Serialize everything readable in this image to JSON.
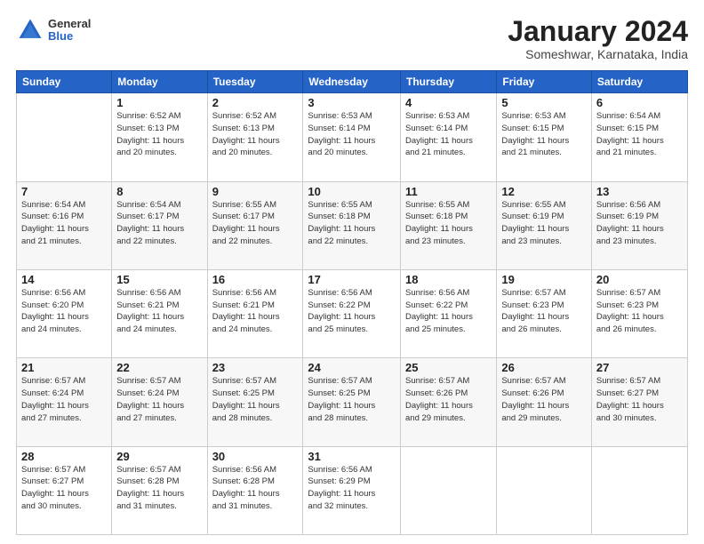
{
  "header": {
    "logo_general": "General",
    "logo_blue": "Blue",
    "title": "January 2024",
    "subtitle": "Someshwar, Karnataka, India"
  },
  "weekdays": [
    "Sunday",
    "Monday",
    "Tuesday",
    "Wednesday",
    "Thursday",
    "Friday",
    "Saturday"
  ],
  "weeks": [
    [
      {
        "day": "",
        "info": ""
      },
      {
        "day": "1",
        "info": "Sunrise: 6:52 AM\nSunset: 6:13 PM\nDaylight: 11 hours\nand 20 minutes."
      },
      {
        "day": "2",
        "info": "Sunrise: 6:52 AM\nSunset: 6:13 PM\nDaylight: 11 hours\nand 20 minutes."
      },
      {
        "day": "3",
        "info": "Sunrise: 6:53 AM\nSunset: 6:14 PM\nDaylight: 11 hours\nand 20 minutes."
      },
      {
        "day": "4",
        "info": "Sunrise: 6:53 AM\nSunset: 6:14 PM\nDaylight: 11 hours\nand 21 minutes."
      },
      {
        "day": "5",
        "info": "Sunrise: 6:53 AM\nSunset: 6:15 PM\nDaylight: 11 hours\nand 21 minutes."
      },
      {
        "day": "6",
        "info": "Sunrise: 6:54 AM\nSunset: 6:15 PM\nDaylight: 11 hours\nand 21 minutes."
      }
    ],
    [
      {
        "day": "7",
        "info": "Sunrise: 6:54 AM\nSunset: 6:16 PM\nDaylight: 11 hours\nand 21 minutes."
      },
      {
        "day": "8",
        "info": "Sunrise: 6:54 AM\nSunset: 6:17 PM\nDaylight: 11 hours\nand 22 minutes."
      },
      {
        "day": "9",
        "info": "Sunrise: 6:55 AM\nSunset: 6:17 PM\nDaylight: 11 hours\nand 22 minutes."
      },
      {
        "day": "10",
        "info": "Sunrise: 6:55 AM\nSunset: 6:18 PM\nDaylight: 11 hours\nand 22 minutes."
      },
      {
        "day": "11",
        "info": "Sunrise: 6:55 AM\nSunset: 6:18 PM\nDaylight: 11 hours\nand 23 minutes."
      },
      {
        "day": "12",
        "info": "Sunrise: 6:55 AM\nSunset: 6:19 PM\nDaylight: 11 hours\nand 23 minutes."
      },
      {
        "day": "13",
        "info": "Sunrise: 6:56 AM\nSunset: 6:19 PM\nDaylight: 11 hours\nand 23 minutes."
      }
    ],
    [
      {
        "day": "14",
        "info": "Sunrise: 6:56 AM\nSunset: 6:20 PM\nDaylight: 11 hours\nand 24 minutes."
      },
      {
        "day": "15",
        "info": "Sunrise: 6:56 AM\nSunset: 6:21 PM\nDaylight: 11 hours\nand 24 minutes."
      },
      {
        "day": "16",
        "info": "Sunrise: 6:56 AM\nSunset: 6:21 PM\nDaylight: 11 hours\nand 24 minutes."
      },
      {
        "day": "17",
        "info": "Sunrise: 6:56 AM\nSunset: 6:22 PM\nDaylight: 11 hours\nand 25 minutes."
      },
      {
        "day": "18",
        "info": "Sunrise: 6:56 AM\nSunset: 6:22 PM\nDaylight: 11 hours\nand 25 minutes."
      },
      {
        "day": "19",
        "info": "Sunrise: 6:57 AM\nSunset: 6:23 PM\nDaylight: 11 hours\nand 26 minutes."
      },
      {
        "day": "20",
        "info": "Sunrise: 6:57 AM\nSunset: 6:23 PM\nDaylight: 11 hours\nand 26 minutes."
      }
    ],
    [
      {
        "day": "21",
        "info": "Sunrise: 6:57 AM\nSunset: 6:24 PM\nDaylight: 11 hours\nand 27 minutes."
      },
      {
        "day": "22",
        "info": "Sunrise: 6:57 AM\nSunset: 6:24 PM\nDaylight: 11 hours\nand 27 minutes."
      },
      {
        "day": "23",
        "info": "Sunrise: 6:57 AM\nSunset: 6:25 PM\nDaylight: 11 hours\nand 28 minutes."
      },
      {
        "day": "24",
        "info": "Sunrise: 6:57 AM\nSunset: 6:25 PM\nDaylight: 11 hours\nand 28 minutes."
      },
      {
        "day": "25",
        "info": "Sunrise: 6:57 AM\nSunset: 6:26 PM\nDaylight: 11 hours\nand 29 minutes."
      },
      {
        "day": "26",
        "info": "Sunrise: 6:57 AM\nSunset: 6:26 PM\nDaylight: 11 hours\nand 29 minutes."
      },
      {
        "day": "27",
        "info": "Sunrise: 6:57 AM\nSunset: 6:27 PM\nDaylight: 11 hours\nand 30 minutes."
      }
    ],
    [
      {
        "day": "28",
        "info": "Sunrise: 6:57 AM\nSunset: 6:27 PM\nDaylight: 11 hours\nand 30 minutes."
      },
      {
        "day": "29",
        "info": "Sunrise: 6:57 AM\nSunset: 6:28 PM\nDaylight: 11 hours\nand 31 minutes."
      },
      {
        "day": "30",
        "info": "Sunrise: 6:56 AM\nSunset: 6:28 PM\nDaylight: 11 hours\nand 31 minutes."
      },
      {
        "day": "31",
        "info": "Sunrise: 6:56 AM\nSunset: 6:29 PM\nDaylight: 11 hours\nand 32 minutes."
      },
      {
        "day": "",
        "info": ""
      },
      {
        "day": "",
        "info": ""
      },
      {
        "day": "",
        "info": ""
      }
    ]
  ]
}
